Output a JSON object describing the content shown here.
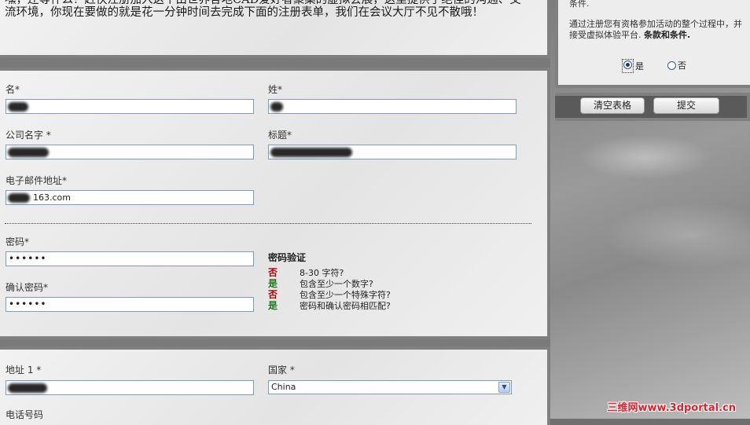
{
  "intro_text": "嘿，还等什么？赶快注册加入这个由世界各地CAD爱好者聚集的虚拟会展，这里提供了绝佳的沟通、交流环境，你现在要做的就是花一分钟时间去完成下面的注册表单，我们在会议大厅不见不散哦！",
  "form": {
    "first_name_label": "名*",
    "last_name_label": "姓*",
    "company_label": "公司名字 *",
    "title_label": "标题*",
    "email_label": "电子邮件地址*",
    "email_value": "163.com",
    "password_label": "密码*",
    "password_value": "••••••",
    "confirm_label": "确认密码*",
    "confirm_value": "••••••",
    "address_label": "地址 1 *",
    "country_label": "国家 *",
    "country_value": "China",
    "phone_label": "电话号码"
  },
  "password_validation": {
    "title": "密码验证",
    "rows": [
      {
        "status": "否",
        "ok": false,
        "text": "8-30 字符?"
      },
      {
        "status": "是",
        "ok": true,
        "text": "包含至少一个数字?"
      },
      {
        "status": "否",
        "ok": false,
        "text": "包含至少一个特殊字符?"
      },
      {
        "status": "是",
        "ok": true,
        "text": "密码和确认密码相匹配?"
      }
    ]
  },
  "terms": {
    "top_text": "条件.",
    "text_before": "通过注册您有资格参加活动的整个过程中，并接受虚拟体验平台. ",
    "text_bold": "条款和条件.",
    "yes_label": "是",
    "no_label": "否",
    "selected": "yes"
  },
  "buttons": {
    "clear_label": "清空表格",
    "submit_label": "提交"
  },
  "watermark": "三维网www.3dportal.cn"
}
